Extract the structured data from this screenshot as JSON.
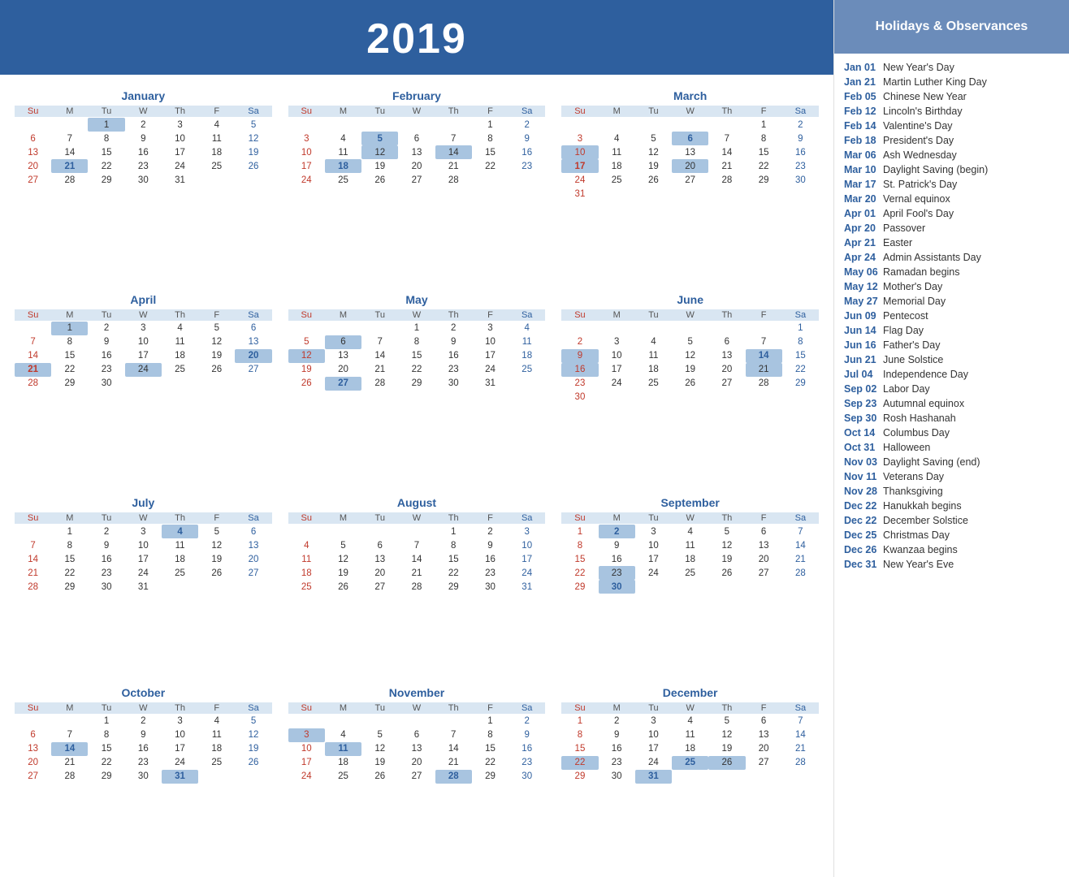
{
  "year": "2019",
  "sidebar_title": "Holidays &\nObservances",
  "holidays": [
    {
      "date": "Jan 01",
      "name": "New Year's Day"
    },
    {
      "date": "Jan 21",
      "name": "Martin Luther King Day"
    },
    {
      "date": "Feb 05",
      "name": "Chinese New Year"
    },
    {
      "date": "Feb 12",
      "name": "Lincoln's Birthday"
    },
    {
      "date": "Feb 14",
      "name": "Valentine's Day"
    },
    {
      "date": "Feb 18",
      "name": "President's Day"
    },
    {
      "date": "Mar 06",
      "name": "Ash Wednesday"
    },
    {
      "date": "Mar 10",
      "name": "Daylight Saving (begin)"
    },
    {
      "date": "Mar 17",
      "name": "St. Patrick's Day"
    },
    {
      "date": "Mar 20",
      "name": "Vernal equinox"
    },
    {
      "date": "Apr 01",
      "name": "April Fool's Day"
    },
    {
      "date": "Apr 20",
      "name": "Passover"
    },
    {
      "date": "Apr 21",
      "name": "Easter"
    },
    {
      "date": "Apr 24",
      "name": "Admin Assistants Day"
    },
    {
      "date": "May 06",
      "name": "Ramadan begins"
    },
    {
      "date": "May 12",
      "name": "Mother's Day"
    },
    {
      "date": "May 27",
      "name": "Memorial Day"
    },
    {
      "date": "Jun 09",
      "name": "Pentecost"
    },
    {
      "date": "Jun 14",
      "name": "Flag Day"
    },
    {
      "date": "Jun 16",
      "name": "Father's Day"
    },
    {
      "date": "Jun 21",
      "name": "June Solstice"
    },
    {
      "date": "Jul 04",
      "name": "Independence Day"
    },
    {
      "date": "Sep 02",
      "name": "Labor Day"
    },
    {
      "date": "Sep 23",
      "name": "Autumnal equinox"
    },
    {
      "date": "Sep 30",
      "name": "Rosh Hashanah"
    },
    {
      "date": "Oct 14",
      "name": "Columbus Day"
    },
    {
      "date": "Oct 31",
      "name": "Halloween"
    },
    {
      "date": "Nov 03",
      "name": "Daylight Saving (end)"
    },
    {
      "date": "Nov 11",
      "name": "Veterans Day"
    },
    {
      "date": "Nov 28",
      "name": "Thanksgiving"
    },
    {
      "date": "Dec 22",
      "name": "Hanukkah begins"
    },
    {
      "date": "Dec 22",
      "name": "December Solstice"
    },
    {
      "date": "Dec 25",
      "name": "Christmas Day"
    },
    {
      "date": "Dec 26",
      "name": "Kwanzaa begins"
    },
    {
      "date": "Dec 31",
      "name": "New Year's Eve"
    }
  ],
  "months": [
    {
      "name": "January",
      "startDay": 2,
      "days": 31
    },
    {
      "name": "February",
      "startDay": 5,
      "days": 28
    },
    {
      "name": "March",
      "startDay": 5,
      "days": 31
    },
    {
      "name": "April",
      "startDay": 1,
      "days": 30
    },
    {
      "name": "May",
      "startDay": 3,
      "days": 31
    },
    {
      "name": "June",
      "startDay": 6,
      "days": 30
    },
    {
      "name": "July",
      "startDay": 1,
      "days": 31
    },
    {
      "name": "August",
      "startDay": 4,
      "days": 31
    },
    {
      "name": "September",
      "startDay": 0,
      "days": 30
    },
    {
      "name": "October",
      "startDay": 2,
      "days": 31
    },
    {
      "name": "November",
      "startDay": 5,
      "days": 30
    },
    {
      "name": "December",
      "startDay": 0,
      "days": 31
    }
  ],
  "day_headers": [
    "Su",
    "M",
    "Tu",
    "W",
    "Th",
    "F",
    "Sa"
  ],
  "highlighted": {
    "January": [
      1,
      21
    ],
    "February": [
      5,
      12,
      14,
      18
    ],
    "March": [
      6,
      10,
      17,
      20
    ],
    "April": [
      1,
      20,
      21,
      24
    ],
    "May": [
      6,
      12,
      27
    ],
    "June": [
      9,
      14,
      16,
      21
    ],
    "July": [
      4
    ],
    "August": [],
    "September": [
      2,
      23,
      30
    ],
    "October": [
      14,
      31
    ],
    "November": [
      3,
      11,
      28
    ],
    "December": [
      22,
      25,
      26,
      31
    ]
  }
}
